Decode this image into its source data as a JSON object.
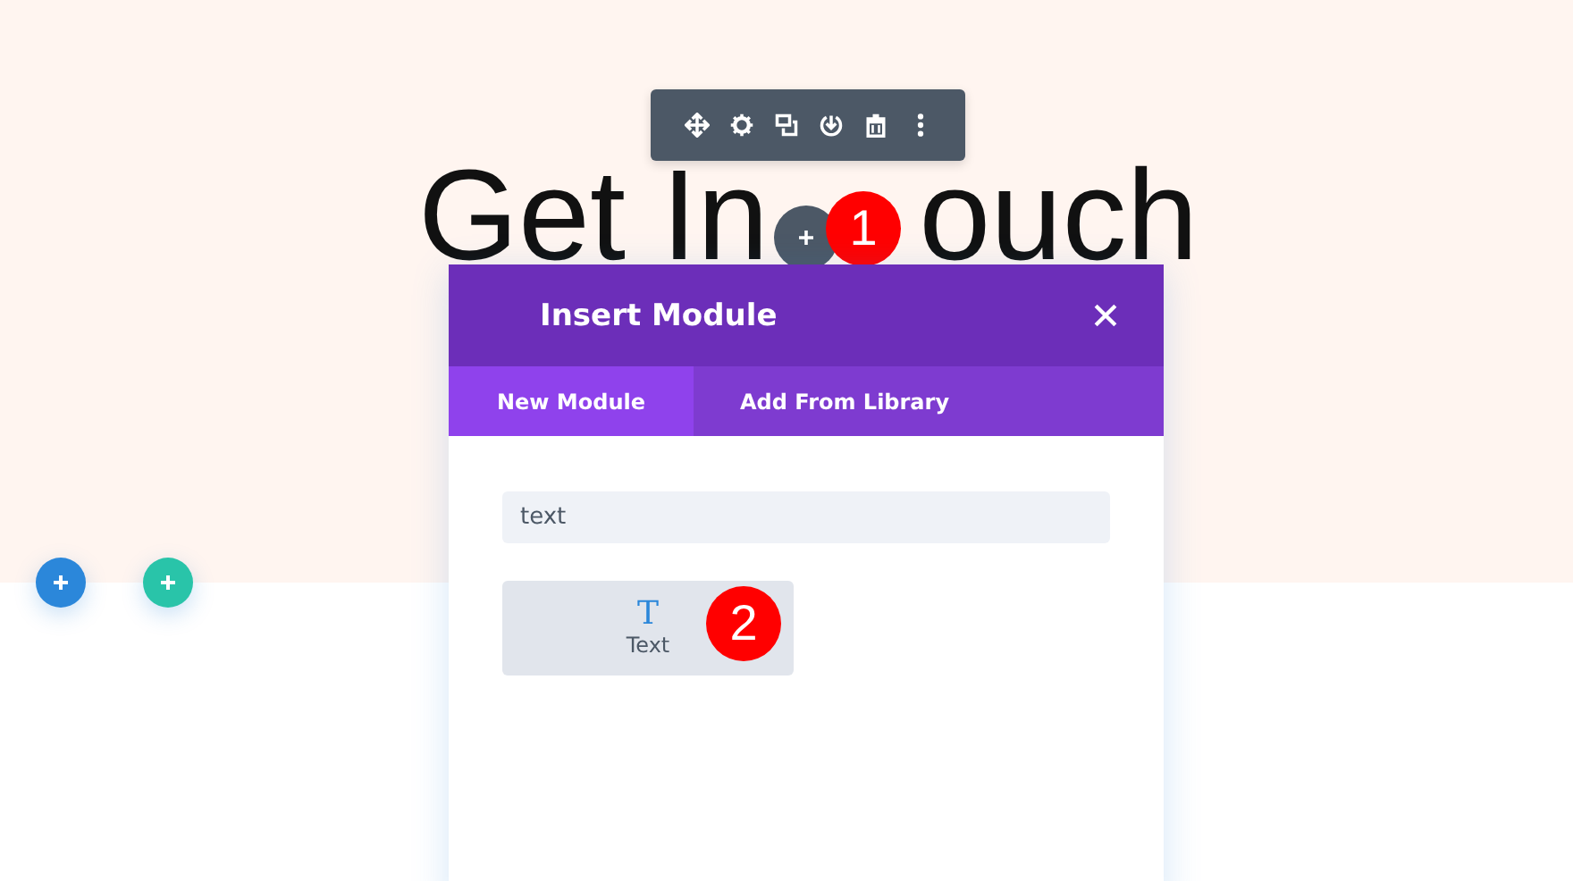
{
  "heading": [
    {
      "text": "Get In"
    },
    {
      "text": "ouch"
    }
  ],
  "module_toolbar": {
    "buttons": [
      {
        "kind": "move"
      },
      {
        "kind": "settings"
      },
      {
        "kind": "duplicate"
      },
      {
        "kind": "save"
      },
      {
        "kind": "delete"
      },
      {
        "kind": "more"
      }
    ]
  },
  "callouts": [
    {
      "label": "1"
    },
    {
      "label": "2"
    }
  ],
  "section_buttons": [
    {
      "color": "#2b87da"
    },
    {
      "color": "#29c4a9"
    }
  ],
  "dialog": {
    "title": "Insert Module",
    "tabs": [
      {
        "label": "New Module",
        "selected": true
      },
      {
        "label": "Add From Library",
        "selected": false
      }
    ],
    "search": {
      "value": "text"
    },
    "modules": [
      {
        "label": "Text",
        "icon": "T"
      }
    ]
  }
}
